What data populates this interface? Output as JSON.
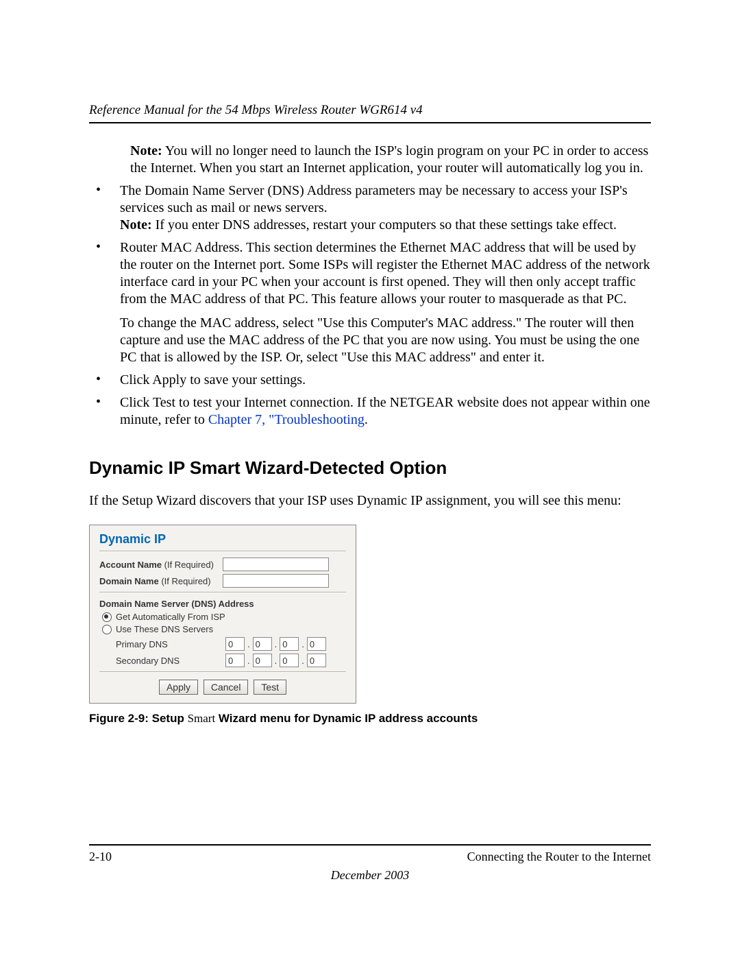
{
  "header": {
    "manual_title": "Reference Manual for the 54 Mbps Wireless Router WGR614 v4"
  },
  "body": {
    "note_para": "Note: You will no longer need to launch the ISP's login program on your PC in order to access the Internet. When you start an Internet application, your router will automatically log you in.",
    "bullet_dns": "The Domain Name Server (DNS) Address parameters may be necessary to access your ISP's services such as mail or news servers.",
    "note_dns": "Note: If you enter DNS addresses, restart your computers so that these settings take effect.",
    "bullet_mac_p1": "Router MAC Address. This section determines the Ethernet MAC address that will be used by the router on the Internet port. Some ISPs will register the Ethernet MAC address of the network interface card in your PC when your account is first opened. They will then only accept traffic from the MAC address of that PC. This feature allows your router to masquerade as that PC.",
    "bullet_mac_p2": "To change the MAC address, select \"Use this Computer's MAC address.\" The router will then capture and use the MAC address of the PC that you are now using. You must be using the one PC that is allowed by the ISP. Or, select \"Use this MAC address\" and enter it.",
    "bullet_apply": "Click Apply to save your settings.",
    "bullet_test_pre": "Click Test to test your Internet connection. If the NETGEAR website does not appear within one minute, refer to ",
    "bullet_test_link": "Chapter 7, \"Troubleshooting",
    "bullet_test_post": "."
  },
  "section": {
    "heading": "Dynamic IP Smart Wizard-Detected Option",
    "intro": "If the Setup Wizard discovers that your ISP uses Dynamic IP assignment, you will see this menu:"
  },
  "panel": {
    "title": "Dynamic IP",
    "account_label_b": "Account Name",
    "account_label_r": " (If Required)",
    "domain_label_b": "Domain Name",
    "domain_label_r": " (If Required)",
    "dns_heading": "Domain Name Server (DNS) Address",
    "radio_auto": "Get Automatically From ISP",
    "radio_use": "Use These DNS Servers",
    "primary_label": "Primary DNS",
    "secondary_label": "Secondary DNS",
    "octet": "0",
    "btn_apply": "Apply",
    "btn_cancel": "Cancel",
    "btn_test": "Test"
  },
  "figure": {
    "prefix": "Figure 2-9:  Setup ",
    "smart": "Smart",
    "suffix": " Wizard menu for Dynamic IP address accounts"
  },
  "footer": {
    "page": "2-10",
    "section": "Connecting the Router to the Internet",
    "date": "December 2003"
  }
}
